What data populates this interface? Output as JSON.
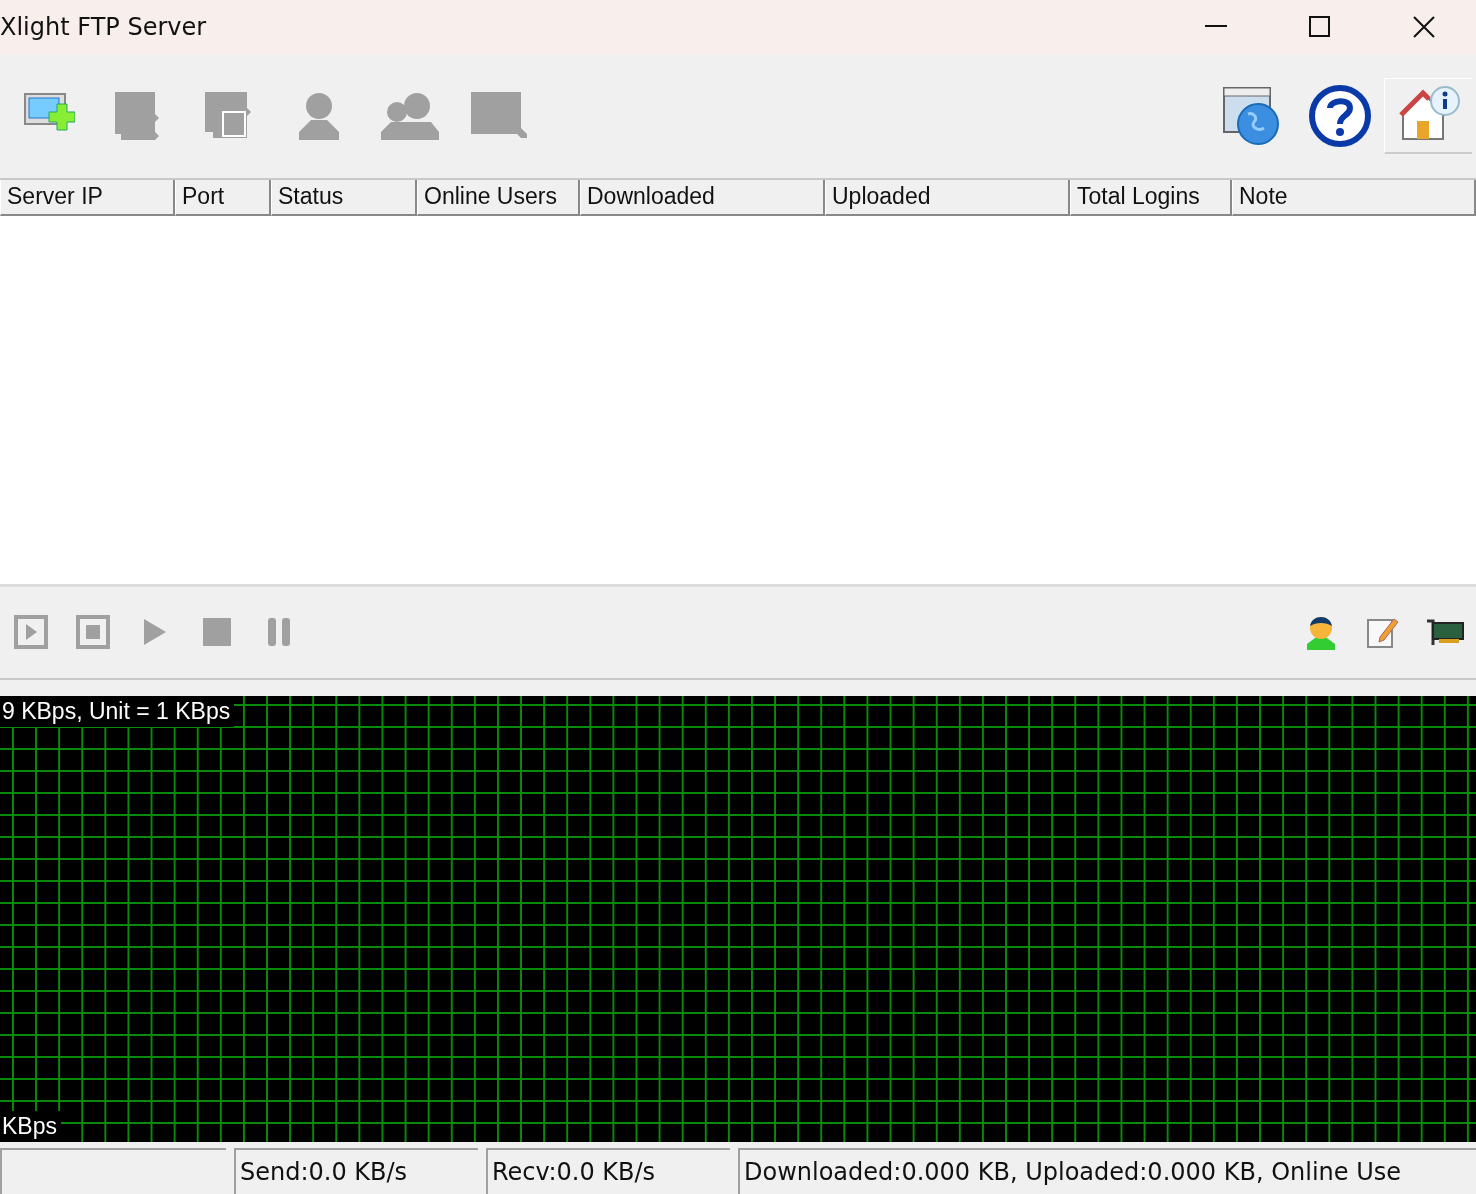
{
  "window": {
    "title": "Xlight FTP Server"
  },
  "toolbar": [
    {
      "kind": "add-server",
      "disabled": false
    },
    {
      "kind": "server",
      "disabled": true
    },
    {
      "kind": "server-doc",
      "disabled": true
    },
    {
      "kind": "user",
      "disabled": true
    },
    {
      "kind": "users",
      "disabled": true
    },
    {
      "kind": "monitor",
      "disabled": true
    }
  ],
  "toolbar_right": [
    {
      "kind": "web"
    },
    {
      "kind": "help"
    },
    {
      "kind": "home-info"
    }
  ],
  "table": {
    "columns": [
      "Server IP",
      "Port",
      "Status",
      "Online Users",
      "Downloaded",
      "Uploaded",
      "Total Logins",
      "Note"
    ]
  },
  "controls": [
    {
      "kind": "start-box",
      "disabled": true
    },
    {
      "kind": "stop-box",
      "disabled": true
    },
    {
      "kind": "play",
      "disabled": true
    },
    {
      "kind": "stop",
      "disabled": true
    },
    {
      "kind": "pause",
      "disabled": true
    }
  ],
  "controls_right": [
    {
      "kind": "person"
    },
    {
      "kind": "edit"
    },
    {
      "kind": "card"
    }
  ],
  "graph": {
    "top_label": "9 KBps, Unit = 1 KBps",
    "bottom_label": "KBps"
  },
  "status_bar": [
    "Send:0.0 KB/s",
    "Recv:0.0 KB/s",
    "Downloaded:0.000 KB, Uploaded:0.000 KB, Online Use"
  ]
}
